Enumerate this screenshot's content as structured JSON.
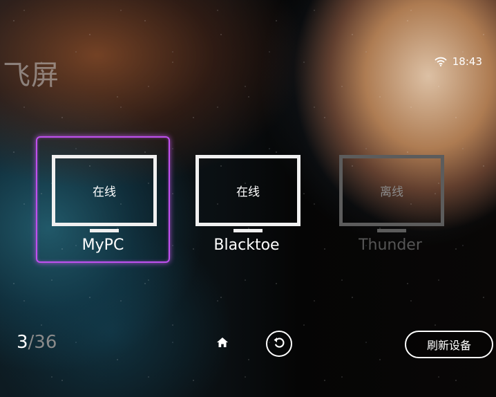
{
  "app": {
    "title": "飞屏"
  },
  "status_bar": {
    "wifi_icon": "wifi-icon",
    "time": "18:43"
  },
  "devices": [
    {
      "name": "MyPC",
      "status": "在线",
      "state": "online",
      "selected": true
    },
    {
      "name": "Blacktoe",
      "status": "在线",
      "state": "online",
      "selected": false
    },
    {
      "name": "Thunder",
      "status": "离线",
      "state": "offline",
      "selected": false
    }
  ],
  "pager": {
    "current": "3",
    "total": "/36"
  },
  "nav": {
    "home_icon": "home-icon",
    "back_icon": "back-icon"
  },
  "refresh_button": {
    "label": "刷新设备"
  },
  "colors": {
    "selection": "#c050f0",
    "online": "#f0f0f0",
    "offline": "#5c5c5c"
  }
}
